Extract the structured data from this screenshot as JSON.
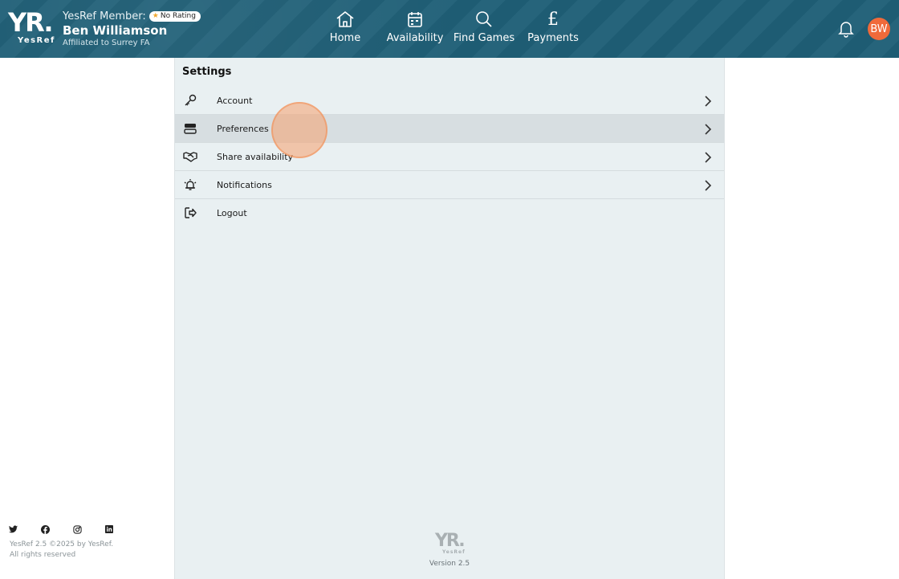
{
  "header": {
    "logo_text": "YR.",
    "logo_sub": "YesRef",
    "member_label": "YesRef Member:",
    "rating_badge": "No Rating",
    "member_name": "Ben Williamson",
    "affiliation": "Affiliated to Surrey FA",
    "nav": [
      {
        "label": "Home",
        "icon": "home-icon"
      },
      {
        "label": "Availability",
        "icon": "calendar-icon"
      },
      {
        "label": "Find Games",
        "icon": "search-icon"
      },
      {
        "label": "Payments",
        "icon": "pound-icon"
      }
    ],
    "avatar_initials": "BW",
    "colors": {
      "header_bg": "#1f5f77",
      "avatar_bg": "#f06a3a"
    }
  },
  "settings": {
    "title": "Settings",
    "items": [
      {
        "label": "Account",
        "icon": "key-icon",
        "chevron": true
      },
      {
        "label": "Preferences",
        "icon": "preferences-icon",
        "chevron": true,
        "active": true
      },
      {
        "label": "Share availability",
        "icon": "handshake-icon",
        "chevron": true
      },
      {
        "label": "Notifications",
        "icon": "alarm-bell-icon",
        "chevron": true
      },
      {
        "label": "Logout",
        "icon": "logout-icon",
        "chevron": false
      }
    ],
    "footer_logo_text": "YR.",
    "footer_logo_sub": "YesRef",
    "version": "Version 2.5"
  },
  "footer": {
    "social": [
      "twitter-icon",
      "facebook-icon",
      "instagram-icon",
      "linkedin-icon"
    ],
    "copyright_line1": "YesRef 2.5 ©2025 by YesRef.",
    "copyright_line2": "All rights reserved"
  }
}
